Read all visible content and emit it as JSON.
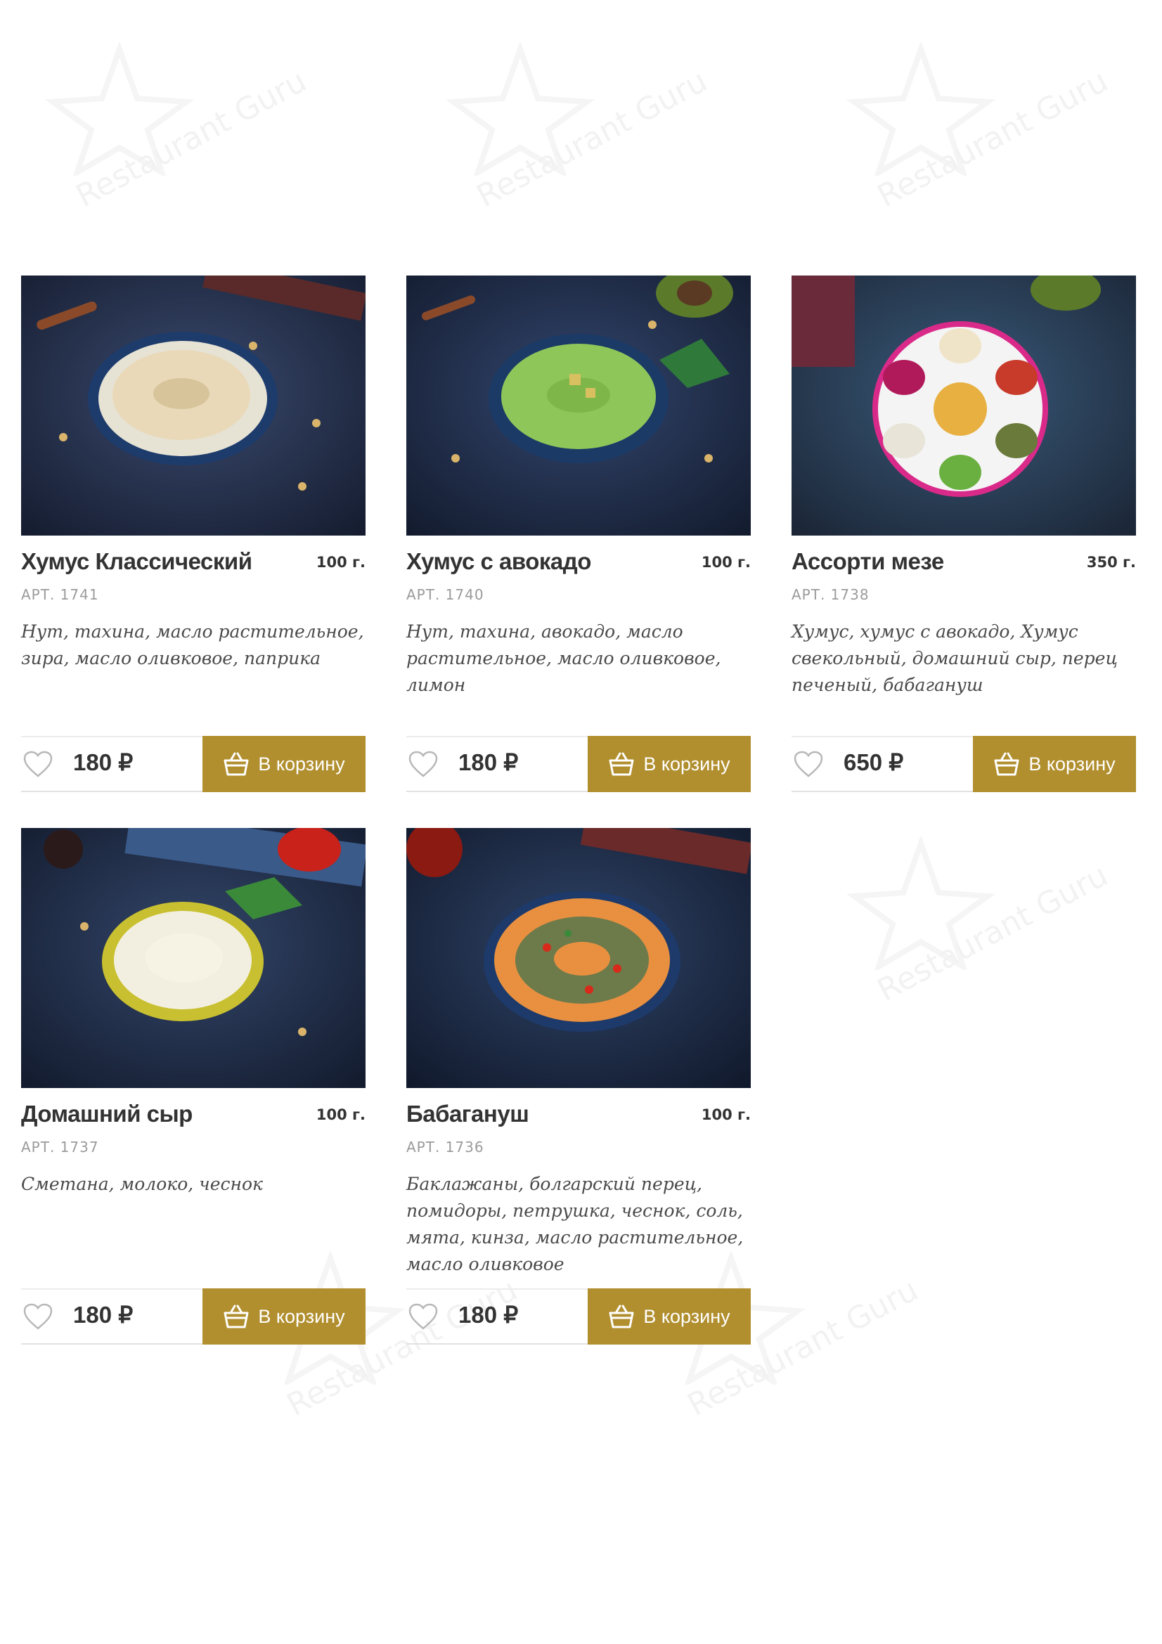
{
  "watermark_text": "Restaurant Guru",
  "cart_label": "В корзину",
  "currency": "₽",
  "colors": {
    "accent": "#b18f2f",
    "title": "#333333",
    "sku": "#9b9b9b",
    "description": "#4a4a4a"
  },
  "products": [
    {
      "name": "Хумус Классический",
      "weight": "100 г.",
      "sku": "АРТ. 1741",
      "description": "Нут, тахина, масло растительное, зира, масло оливковое, паприка",
      "price": "180 ₽",
      "photo": "hummus-classic",
      "dish_color": "#e9d9b8"
    },
    {
      "name": "Хумус с авокадо",
      "weight": "100 г.",
      "sku": "АРТ. 1740",
      "description": "Нут, тахина, авокадо, масло растительное, масло оливковое, лимон",
      "price": "180 ₽",
      "photo": "hummus-avocado",
      "dish_color": "#8fc65a"
    },
    {
      "name": "Ассорти мезе",
      "weight": "350 г.",
      "sku": "АРТ. 1738",
      "description": "Хумус, хумус с авокадо, Хумус свекольный, домашний сыр, перец печеный, бабагануш",
      "price": "650 ₽",
      "photo": "meze-assorti",
      "dish_color": "#ffffff"
    },
    {
      "name": "Домашний сыр",
      "weight": "100 г.",
      "sku": "АРТ. 1737",
      "description": "Сметана, молоко, чеснок",
      "price": "180 ₽",
      "photo": "homemade-cheese",
      "dish_color": "#f3efe0"
    },
    {
      "name": "Бабагануш",
      "weight": "100 г.",
      "sku": "АРТ. 1736",
      "description": "Баклажаны, болгарский перец, помидоры, петрушка, чеснок, соль, мята, кинза, масло растительное, масло оливковое",
      "price": "180 ₽",
      "photo": "babaganoush",
      "dish_color": "#6d7a4a"
    }
  ]
}
